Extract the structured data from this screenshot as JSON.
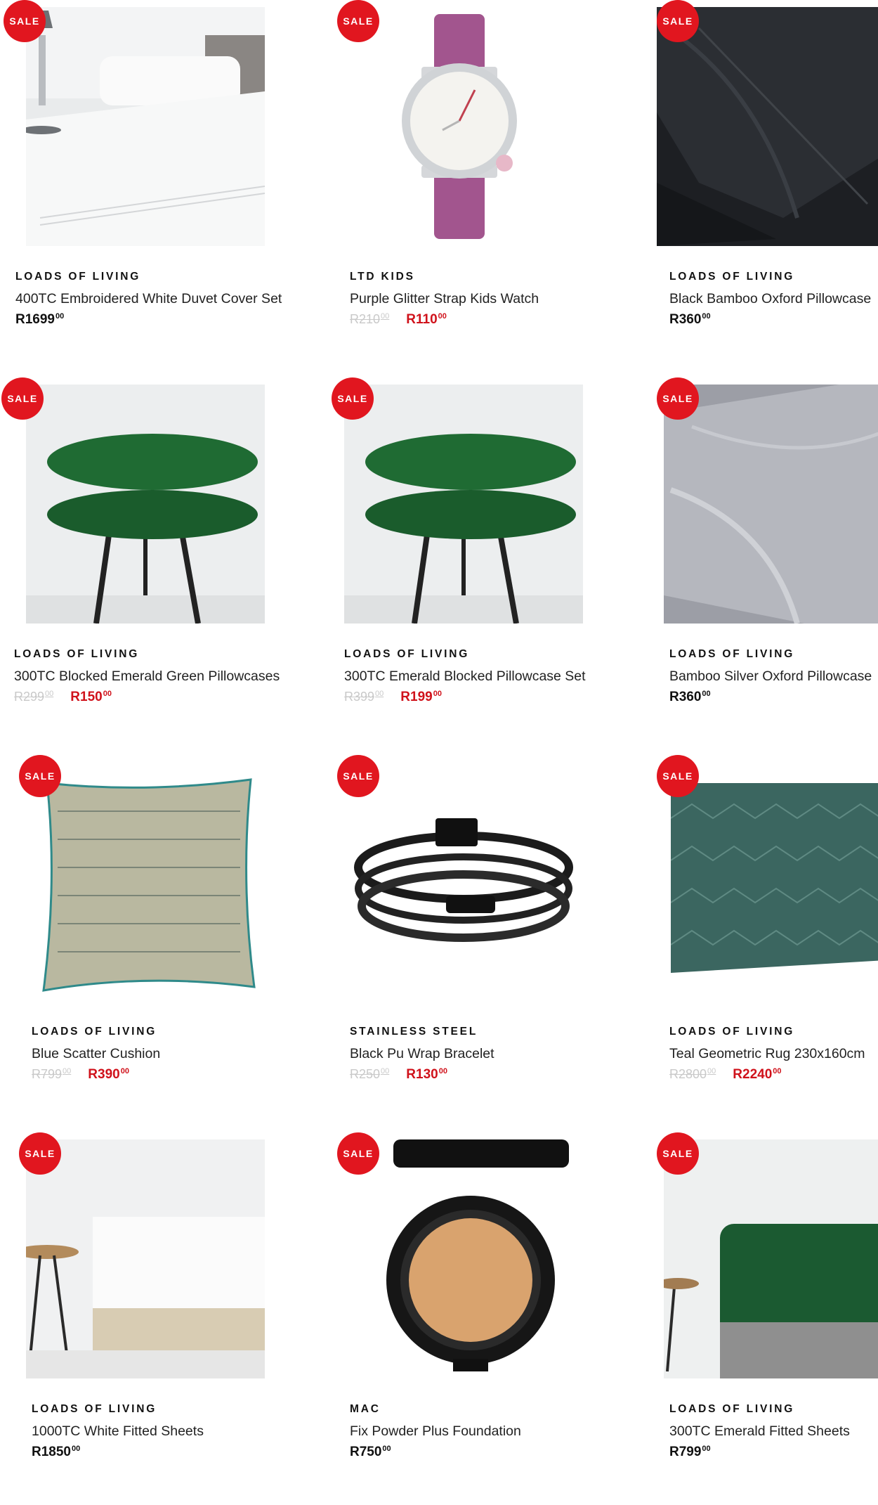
{
  "badge_label": "SALE",
  "colors": {
    "sale_badge": "#e1161f",
    "sale_price": "#d0121b",
    "old_price": "#c9c9c9"
  },
  "products": [
    {
      "brand": "LOADS OF LIVING",
      "title": "400TC Embroidered White Duvet Cover Set",
      "price": {
        "old": "",
        "old_cents": "",
        "now": "R1699",
        "now_cents": "00"
      },
      "image": "white-duvet-bed-photo"
    },
    {
      "brand": "LTD KIDS",
      "title": "Purple Glitter Strap Kids Watch",
      "price": {
        "old": "R210",
        "old_cents": "00",
        "now": "R110",
        "now_cents": "00"
      },
      "image": "purple-watch-photo"
    },
    {
      "brand": "LOADS OF LIVING",
      "title": "Black Bamboo Oxford Pillowcase",
      "price": {
        "old": "",
        "old_cents": "",
        "now": "R360",
        "now_cents": "00"
      },
      "image": "black-pillowcase-photo"
    },
    {
      "brand": "LOADS OF LIVING",
      "title": "300TC Blocked Emerald Green Pillowcases",
      "price": {
        "old": "R299",
        "old_cents": "00",
        "now": "R150",
        "now_cents": "00"
      },
      "image": "green-pillows-on-stool-photo"
    },
    {
      "brand": "LOADS OF LIVING",
      "title": "300TC Emerald Blocked Pillowcase Set",
      "price": {
        "old": "R399",
        "old_cents": "00",
        "now": "R199",
        "now_cents": "00"
      },
      "image": "green-pillows-on-stool-photo"
    },
    {
      "brand": "LOADS OF LIVING",
      "title": "Bamboo Silver Oxford Pillowcase",
      "price": {
        "old": "",
        "old_cents": "",
        "now": "R360",
        "now_cents": "00"
      },
      "image": "silver-pillowcase-photo"
    },
    {
      "brand": "LOADS OF LIVING",
      "title": "Blue Scatter Cushion",
      "price": {
        "old": "R799",
        "old_cents": "00",
        "now": "R390",
        "now_cents": "00"
      },
      "image": "scatter-cushion-photo"
    },
    {
      "brand": "STAINLESS STEEL",
      "title": "Black Pu Wrap Bracelet",
      "price": {
        "old": "R250",
        "old_cents": "00",
        "now": "R130",
        "now_cents": "00"
      },
      "image": "black-bracelet-photo"
    },
    {
      "brand": "LOADS OF LIVING",
      "title": "Teal Geometric Rug 230x160cm",
      "price": {
        "old": "R2800",
        "old_cents": "00",
        "now": "R2240",
        "now_cents": "00"
      },
      "image": "teal-rug-photo"
    },
    {
      "brand": "LOADS OF LIVING",
      "title": "1000TC White Fitted Sheets",
      "price": {
        "old": "",
        "old_cents": "",
        "now": "R1850",
        "now_cents": "00"
      },
      "image": "white-fitted-sheet-photo"
    },
    {
      "brand": "MAC",
      "title": "Fix Powder Plus Foundation",
      "price": {
        "old": "",
        "old_cents": "",
        "now": "R750",
        "now_cents": "00"
      },
      "image": "powder-compact-photo"
    },
    {
      "brand": "LOADS OF LIVING",
      "title": "300TC Emerald Fitted Sheets",
      "price": {
        "old": "",
        "old_cents": "",
        "now": "R799",
        "now_cents": "00"
      },
      "image": "green-fitted-sheet-photo"
    }
  ]
}
